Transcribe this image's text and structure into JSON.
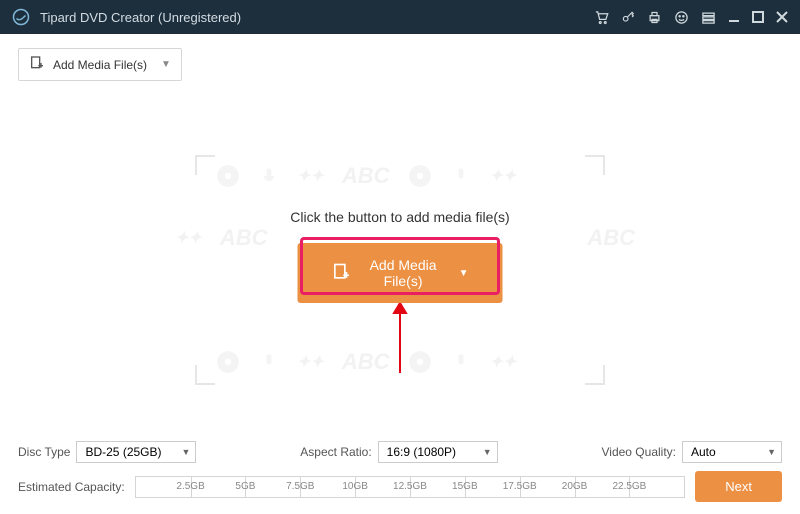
{
  "header": {
    "title": "Tipard DVD Creator (Unregistered)"
  },
  "toolbar": {
    "add_media_small": "Add Media File(s)"
  },
  "drop": {
    "instruction": "Click the button to add media file(s)",
    "add_media_big": "Add Media File(s)",
    "watermark_text": "ABC"
  },
  "bottom": {
    "disc_type_label": "Disc Type",
    "disc_type_value": "BD-25 (25GB)",
    "aspect_ratio_label": "Aspect Ratio:",
    "aspect_ratio_value": "16:9 (1080P)",
    "video_quality_label": "Video Quality:",
    "video_quality_value": "Auto",
    "capacity_label": "Estimated Capacity:",
    "ticks": [
      "2.5GB",
      "5GB",
      "7.5GB",
      "10GB",
      "12.5GB",
      "15GB",
      "17.5GB",
      "20GB",
      "22.5GB"
    ],
    "next": "Next"
  }
}
